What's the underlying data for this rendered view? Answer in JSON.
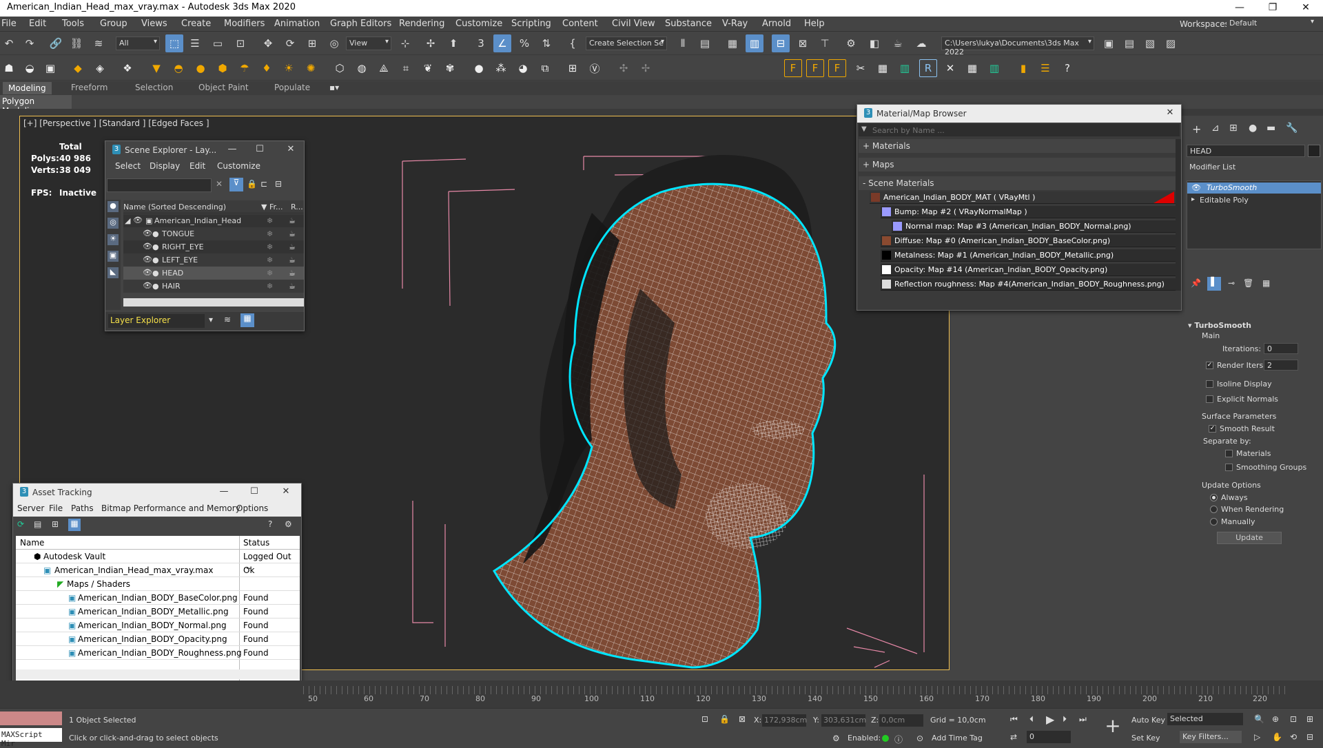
{
  "window": {
    "title": "American_Indian_Head_max_vray.max - Autodesk 3ds Max 2020"
  },
  "menu": {
    "items": [
      "File",
      "Edit",
      "Tools",
      "Group",
      "Views",
      "Create",
      "Modifiers",
      "Animation",
      "Graph Editors",
      "Rendering",
      "Customize",
      "Scripting",
      "Content",
      "Civil View",
      "Substance",
      "V-Ray",
      "Arnold",
      "Help"
    ],
    "workspace_label": "Workspaces:",
    "workspace_value": "Default"
  },
  "toolbar": {
    "filter_value": "All",
    "refcoord_value": "View",
    "selection_set_value": "Create Selection Se",
    "path_value": "C:\\Users\\lukya\\Documents\\3ds Max 2022"
  },
  "ribbon": {
    "tabs": [
      "Modeling",
      "Freeform",
      "Selection",
      "Object Paint",
      "Populate"
    ],
    "panel": "Polygon Modeling"
  },
  "viewport": {
    "label": "[+] [Perspective ] [Standard ] [Edged Faces ]",
    "stats": {
      "total_label": "Total",
      "polys_label": "Polys:",
      "polys_value": "40 986",
      "verts_label": "Verts:",
      "verts_value": "38 049",
      "fps_label": "FPS:",
      "fps_value": "Inactive"
    }
  },
  "scene_explorer": {
    "title": "Scene Explorer - Lay...",
    "menu": [
      "Select",
      "Display",
      "Edit",
      "Customize"
    ],
    "columns": {
      "name": "Name (Sorted Descending)",
      "fr": "▼ Fr...",
      "r": "R..."
    },
    "root": "American_Indian_Head",
    "children": [
      "TONGUE",
      "RIGHT_EYE",
      "LEFT_EYE",
      "HEAD",
      "HAIR"
    ],
    "footer": "Layer Explorer"
  },
  "asset_tracking": {
    "title": "Asset Tracking",
    "menu": [
      "Server",
      "File",
      "Paths",
      "Bitmap Performance and Memory",
      "Options"
    ],
    "columns": [
      "Name",
      "Status"
    ],
    "rows": [
      {
        "name": "Autodesk Vault",
        "status": "Logged Out ..."
      },
      {
        "name": "American_Indian_Head_max_vray.max",
        "status": "Ok"
      },
      {
        "name": "Maps / Shaders",
        "status": ""
      },
      {
        "name": "American_Indian_BODY_BaseColor.png",
        "status": "Found"
      },
      {
        "name": "American_Indian_BODY_Metallic.png",
        "status": "Found"
      },
      {
        "name": "American_Indian_BODY_Normal.png",
        "status": "Found"
      },
      {
        "name": "American_Indian_BODY_Opacity.png",
        "status": "Found"
      },
      {
        "name": "American_Indian_BODY_Roughness.png",
        "status": "Found"
      }
    ]
  },
  "material_browser": {
    "title": "Material/Map Browser",
    "search_placeholder": "Search by Name ...",
    "groups": [
      "+ Materials",
      "+ Maps",
      "- Scene Materials"
    ],
    "items": [
      {
        "text": "American_Indian_BODY_MAT ( VRayMtl )",
        "color": "#7a3a28"
      },
      {
        "text": "Bump: Map #2 ( VRayNormalMap )",
        "color": "#9a9aff"
      },
      {
        "text": "Normal map: Map #3 (American_Indian_BODY_Normal.png)",
        "color": "#9a9aff"
      },
      {
        "text": "Diffuse: Map #0 (American_Indian_BODY_BaseColor.png)",
        "color": "#8a4a30"
      },
      {
        "text": "Metalness: Map #1 (American_Indian_BODY_Metallic.png)",
        "color": "#000000"
      },
      {
        "text": "Opacity: Map #14 (American_Indian_BODY_Opacity.png)",
        "color": "#ffffff"
      },
      {
        "text": "Reflection roughness: Map #4(American_Indian_BODY_Roughness.png)",
        "color": "#dddddd"
      }
    ]
  },
  "command_panel": {
    "object_name": "HEAD",
    "modifier_list": "Modifier List",
    "stack": [
      "TurboSmooth",
      "Editable Poly"
    ],
    "rollout_title": "TurboSmooth",
    "main_label": "Main",
    "iterations_label": "Iterations:",
    "iterations_value": "0",
    "render_iters_label": "Render Iters:",
    "render_iters_value": "2",
    "render_iters_checked": true,
    "isoline_label": "Isoline Display",
    "explicit_normals_label": "Explicit Normals",
    "surface_params_label": "Surface Parameters",
    "smooth_result_label": "Smooth Result",
    "separate_by_label": "Separate by:",
    "materials_label": "Materials",
    "smoothing_groups_label": "Smoothing Groups",
    "update_options_label": "Update Options",
    "always_label": "Always",
    "when_rendering_label": "When Rendering",
    "manually_label": "Manually",
    "update_button": "Update"
  },
  "timeline": {
    "ticks": [
      "50",
      "60",
      "70",
      "80",
      "90",
      "100",
      "110",
      "120",
      "130",
      "140",
      "150",
      "160",
      "170",
      "180",
      "190",
      "200",
      "210",
      "220"
    ]
  },
  "status": {
    "script_label": "MAXScript Mir",
    "selected": "1 Object Selected",
    "prompt": "Click or click-and-drag to select objects",
    "x_label": "X:",
    "x_value": "172,938cm",
    "y_label": "Y:",
    "y_value": "303,631cm",
    "z_label": "Z:",
    "z_value": "0,0cm",
    "grid": "Grid = 10,0cm",
    "enabled_label": "Enabled:",
    "add_time_tag": "Add Time Tag",
    "auto_key": "Auto Key",
    "set_key": "Set Key",
    "selected_dd": "Selected",
    "key_filters": "Key Filters...",
    "frame_value": "0"
  },
  "colors": {
    "accent": "#5b8fc9",
    "selection": "#00e5ff",
    "viewport_bg": "#2b2b2b"
  }
}
